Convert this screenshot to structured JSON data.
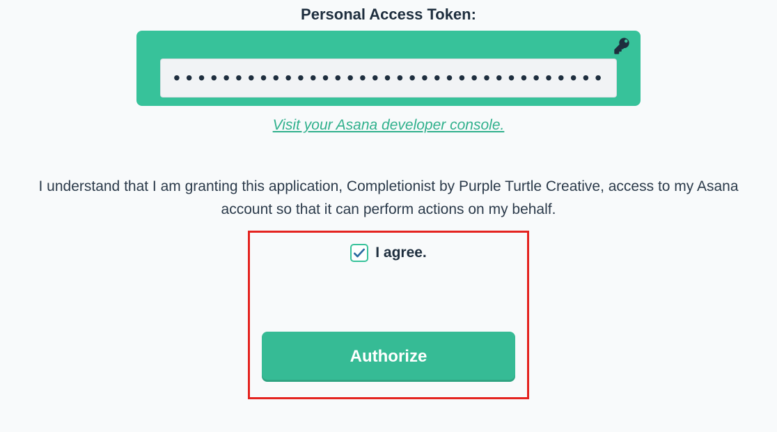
{
  "heading": "Personal Access Token:",
  "token_field": {
    "value": "••••••••••••••••••••••••••••••••••••••••••••••••••"
  },
  "visit_link": {
    "text": "Visit your Asana developer console."
  },
  "disclaimer": "I understand that I am granting this application, Completionist by Purple Turtle Creative, access to my Asana account so that it can perform actions on my behalf.",
  "agree": {
    "label": "I agree.",
    "checked": true
  },
  "authorize_label": "Authorize",
  "colors": {
    "accent": "#37c29a",
    "highlight_border": "#e4231f",
    "text": "#1e2e3e"
  }
}
